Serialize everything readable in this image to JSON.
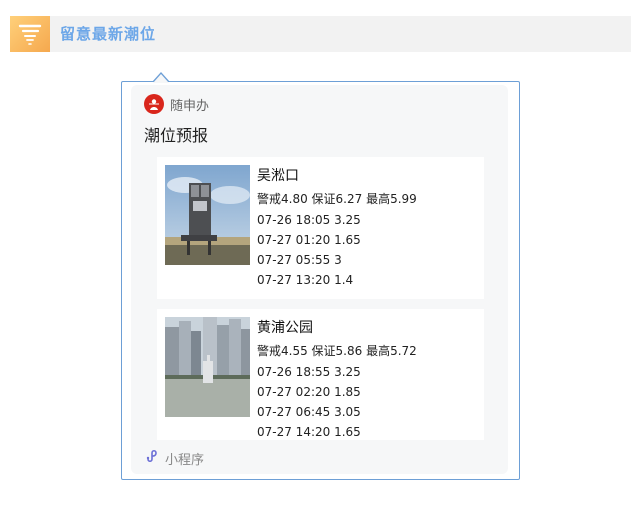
{
  "header": {
    "title": "留意最新潮位",
    "icon": "tornado-icon"
  },
  "card": {
    "app_name": "随申办",
    "title": "潮位预报",
    "stations": [
      {
        "name": "吴淞口",
        "limits": "警戒4.80 保证6.27 最高5.99",
        "tides": [
          "07-26 18:05 3.25",
          "07-27 01:20 1.65",
          "07-27 05:55 3",
          "07-27 13:20 1.4"
        ]
      },
      {
        "name": "黄浦公园",
        "limits": "警戒4.55 保证5.86 最高5.72",
        "tides": [
          "07-26 18:55 3.25",
          "07-27 02:20 1.85",
          "07-27 06:45 3.05",
          "07-27 14:20 1.65"
        ]
      }
    ],
    "footer_label": "小程序",
    "footer_icon": "mini-program-icon"
  },
  "colors": {
    "accent": "#6da7e8",
    "border": "#6d9fd6",
    "app_logo": "#d9261c"
  }
}
